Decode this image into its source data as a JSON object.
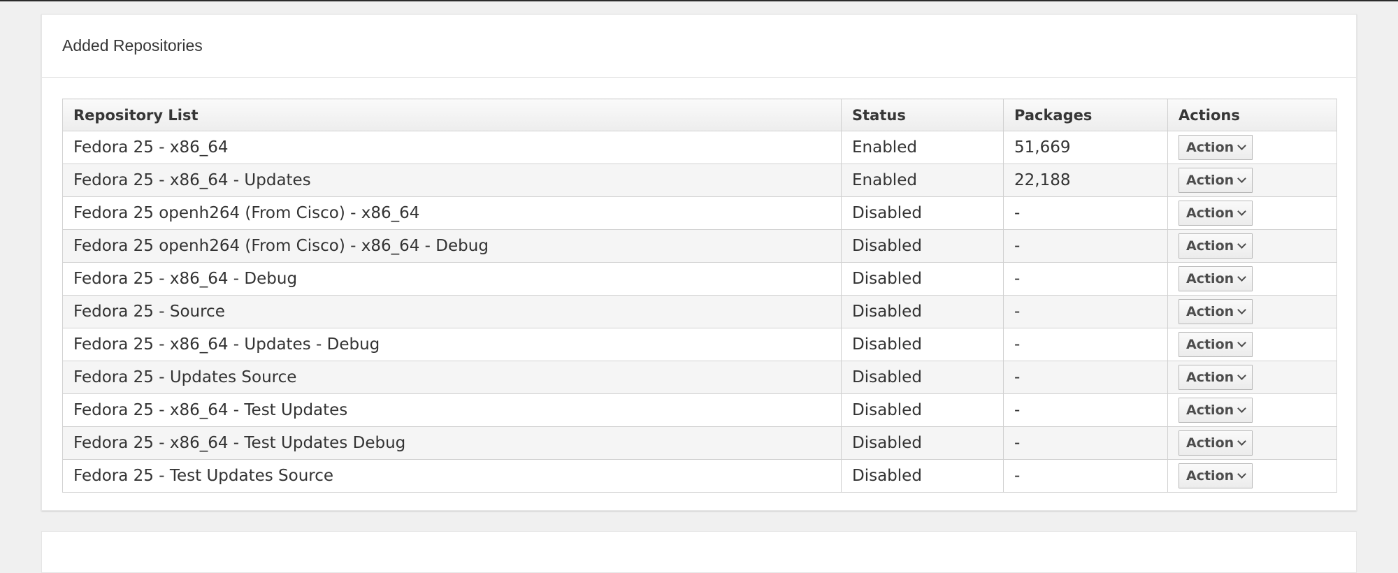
{
  "panel": {
    "title": "Added Repositories"
  },
  "table": {
    "headers": {
      "name": "Repository List",
      "status": "Status",
      "packages": "Packages",
      "actions": "Actions"
    },
    "action_label": "Action",
    "rows": [
      {
        "name": "Fedora 25 - x86_64",
        "status": "Enabled",
        "packages": "51,669"
      },
      {
        "name": "Fedora 25 - x86_64 - Updates",
        "status": "Enabled",
        "packages": "22,188"
      },
      {
        "name": "Fedora 25 openh264 (From Cisco) - x86_64",
        "status": "Disabled",
        "packages": "-"
      },
      {
        "name": "Fedora 25 openh264 (From Cisco) - x86_64 - Debug",
        "status": "Disabled",
        "packages": "-"
      },
      {
        "name": "Fedora 25 - x86_64 - Debug",
        "status": "Disabled",
        "packages": "-"
      },
      {
        "name": "Fedora 25 - Source",
        "status": "Disabled",
        "packages": "-"
      },
      {
        "name": "Fedora 25 - x86_64 - Updates - Debug",
        "status": "Disabled",
        "packages": "-"
      },
      {
        "name": "Fedora 25 - Updates Source",
        "status": "Disabled",
        "packages": "-"
      },
      {
        "name": "Fedora 25 - x86_64 - Test Updates",
        "status": "Disabled",
        "packages": "-"
      },
      {
        "name": "Fedora 25 - x86_64 - Test Updates Debug",
        "status": "Disabled",
        "packages": "-"
      },
      {
        "name": "Fedora 25 - Test Updates Source",
        "status": "Disabled",
        "packages": "-"
      }
    ]
  },
  "icons": {
    "action_caret": "chevron-down-icon"
  }
}
